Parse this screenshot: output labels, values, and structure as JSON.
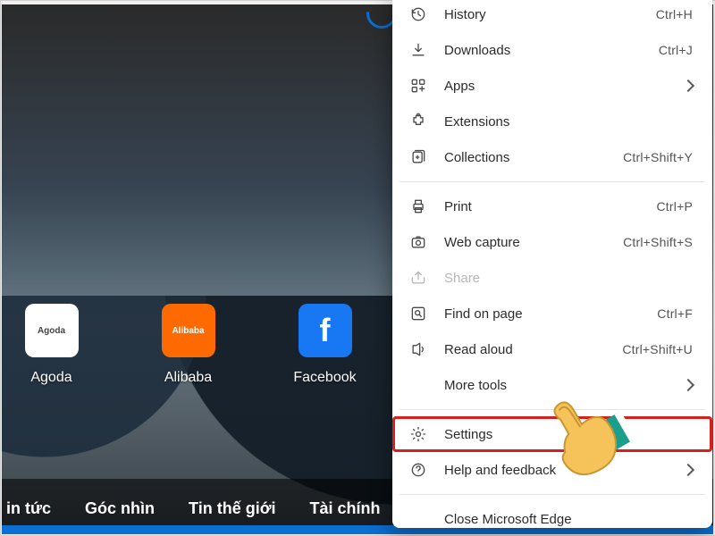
{
  "ntp": {
    "tiles": [
      {
        "label": "Agoda",
        "kind": "agoda"
      },
      {
        "label": "Alibaba",
        "kind": "alibaba"
      },
      {
        "label": "Facebook",
        "kind": "facebook"
      }
    ],
    "feed_tabs": [
      "in tức",
      "Góc nhìn",
      "Tin thế giới",
      "Tài chính"
    ]
  },
  "menu": {
    "items": [
      {
        "id": "history",
        "label": "History",
        "kbd": "Ctrl+H",
        "icon": "history-icon"
      },
      {
        "id": "downloads",
        "label": "Downloads",
        "kbd": "Ctrl+J",
        "icon": "download-icon"
      },
      {
        "id": "apps",
        "label": "Apps",
        "submenu": true,
        "icon": "apps-icon"
      },
      {
        "id": "extensions",
        "label": "Extensions",
        "icon": "extensions-icon"
      },
      {
        "id": "collections",
        "label": "Collections",
        "kbd": "Ctrl+Shift+Y",
        "icon": "collections-icon"
      },
      {
        "divider": true
      },
      {
        "id": "print",
        "label": "Print",
        "kbd": "Ctrl+P",
        "icon": "print-icon"
      },
      {
        "id": "webcapture",
        "label": "Web capture",
        "kbd": "Ctrl+Shift+S",
        "icon": "capture-icon"
      },
      {
        "id": "share",
        "label": "Share",
        "disabled": true,
        "icon": "share-icon"
      },
      {
        "id": "find",
        "label": "Find on page",
        "kbd": "Ctrl+F",
        "icon": "find-icon"
      },
      {
        "id": "readaloud",
        "label": "Read aloud",
        "kbd": "Ctrl+Shift+U",
        "icon": "readaloud-icon"
      },
      {
        "id": "moretools",
        "label": "More tools",
        "submenu": true
      },
      {
        "divider": true
      },
      {
        "id": "settings",
        "label": "Settings",
        "highlight": true,
        "icon": "settings-icon"
      },
      {
        "id": "help",
        "label": "Help and feedback",
        "submenu": true,
        "icon": "help-icon"
      },
      {
        "divider": true
      },
      {
        "id": "close",
        "label": "Close Microsoft Edge"
      }
    ]
  }
}
